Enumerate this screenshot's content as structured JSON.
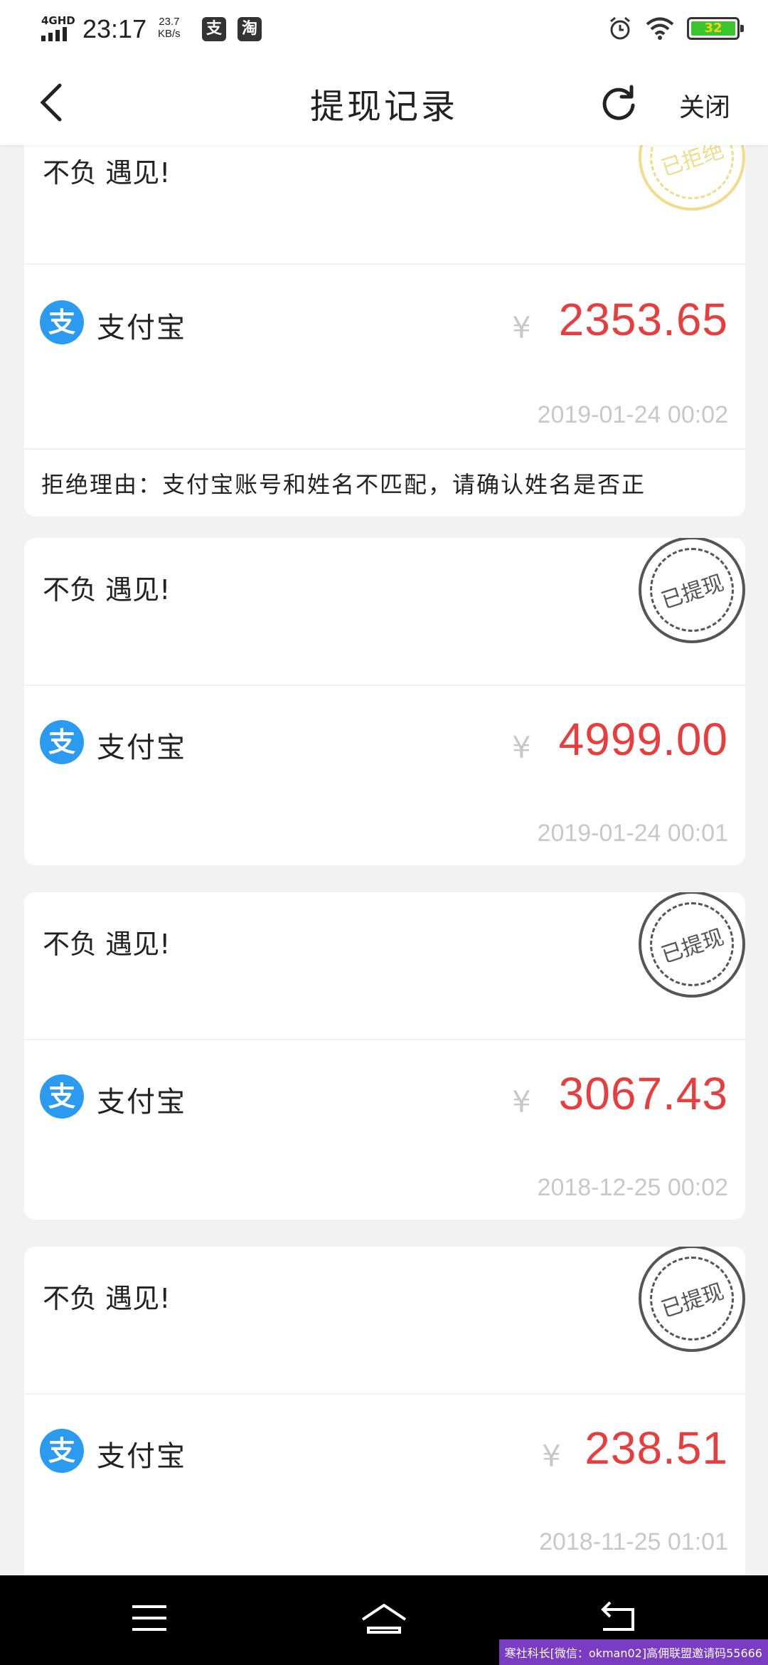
{
  "status_bar": {
    "network": "4GHD",
    "time": "23:17",
    "speed_value": "23.7",
    "speed_unit": "KB/s",
    "app_icons": [
      "支",
      "淘"
    ],
    "battery": "32"
  },
  "header": {
    "title": "提现记录",
    "close_label": "关闭"
  },
  "records": [
    {
      "name": "不负 遇见!",
      "stamp": "已拒绝",
      "method": "支付宝",
      "method_icon": "支",
      "currency": "¥",
      "amount": "2353.65",
      "date": "2019-01-24 00:02",
      "reason": "拒绝理由：支付宝账号和姓名不匹配，请确认姓名是否正"
    },
    {
      "name": "不负 遇见!",
      "stamp": "已提现",
      "method": "支付宝",
      "method_icon": "支",
      "currency": "¥",
      "amount": "4999.00",
      "date": "2019-01-24 00:01"
    },
    {
      "name": "不负 遇见!",
      "stamp": "已提现",
      "method": "支付宝",
      "method_icon": "支",
      "currency": "¥",
      "amount": "3067.43",
      "date": "2018-12-25 00:02"
    },
    {
      "name": "不负 遇见!",
      "stamp": "已提现",
      "method": "支付宝",
      "method_icon": "支",
      "currency": "¥",
      "amount": "238.51",
      "date": "2018-11-25 01:01"
    }
  ],
  "watermark": "寒社科长[微信：okman02]高佣联盟邀请码55666",
  "colors": {
    "amount": "#e83d3d",
    "alipay": "#2a9bf0",
    "reject_stamp": "#f0dc8a",
    "done_stamp": "#555555"
  }
}
